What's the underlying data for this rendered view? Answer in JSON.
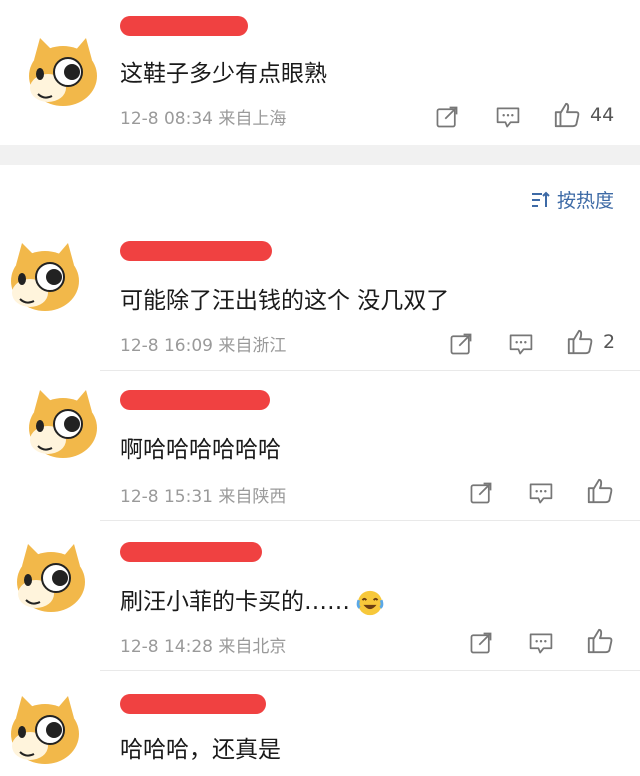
{
  "sort_label": "按热度",
  "comments": [
    {
      "text": "这鞋子多少有点眼熟",
      "date": "12-8 08:34",
      "location": "来自上海",
      "likes": "44"
    },
    {
      "text": "可能除了汪出钱的这个 没几双了",
      "date": "12-8 16:09",
      "location": "来自浙江",
      "likes": "2"
    },
    {
      "text": "啊哈哈哈哈哈哈",
      "date": "12-8 15:31",
      "location": "来自陕西",
      "likes": ""
    },
    {
      "text": "刷汪小菲的卡买的……",
      "date": "12-8 14:28",
      "location": "来自北京",
      "likes": "",
      "emoji": "laugh-cry-emoji"
    },
    {
      "text": "哈哈哈，还真是",
      "date": "",
      "location": "",
      "likes": ""
    }
  ],
  "colors": {
    "redact": "#f04141",
    "link": "#3d6aa6",
    "meta": "#9a9a9a",
    "gap": "#f1f1f1"
  }
}
